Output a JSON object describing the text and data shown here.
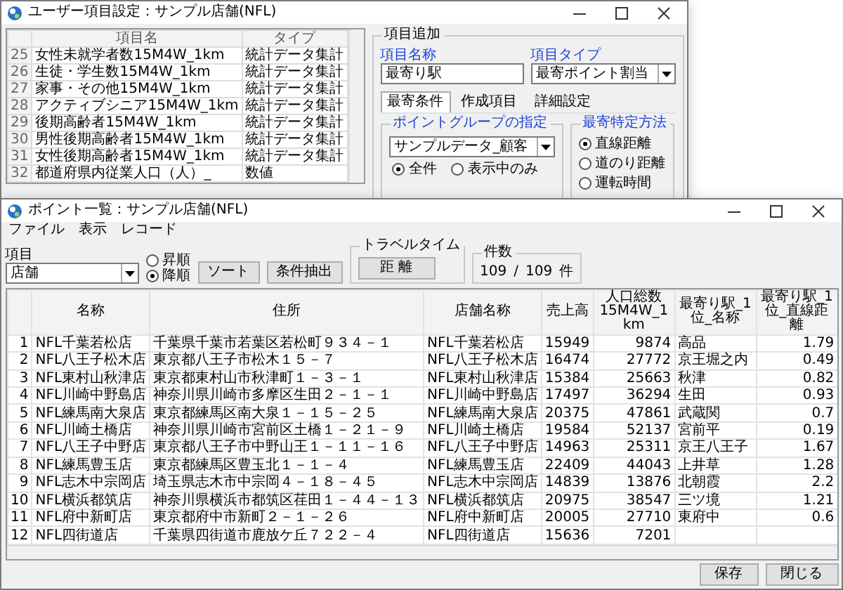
{
  "back_window": {
    "title": "ユーザー項目設定：サンプル店舗(NFL)",
    "list": {
      "columns": [
        "項目名",
        "タイプ"
      ],
      "rows": [
        {
          "number": "25",
          "name": "女性未就学者数15M4W_1km",
          "type": "統計データ集計"
        },
        {
          "number": "26",
          "name": "生徒・学生数15M4W_1km",
          "type": "統計データ集計"
        },
        {
          "number": "27",
          "name": "家事・その他15M4W_1km",
          "type": "統計データ集計"
        },
        {
          "number": "28",
          "name": "アクティブシニア15M4W_1km",
          "type": "統計データ集計"
        },
        {
          "number": "29",
          "name": "後期高齢者15M4W_1km",
          "type": "統計データ集計"
        },
        {
          "number": "30",
          "name": "男性後期高齢者15M4W_1km",
          "type": "統計データ集計"
        },
        {
          "number": "31",
          "name": "女性後期高齢者15M4W_1km",
          "type": "統計データ集計"
        },
        {
          "number": "32",
          "name": "都道府県内従業人口（人）_",
          "type": "数値"
        }
      ]
    },
    "add_item": {
      "title": "項目追加",
      "name_label": "項目名称",
      "name_value": "最寄り駅",
      "type_label": "項目タイプ",
      "type_value": "最寄ポイント割当",
      "tabs": [
        {
          "label": "最寄条件",
          "selected": true
        },
        {
          "label": "作成項目",
          "selected": false
        },
        {
          "label": "詳細設定",
          "selected": false
        }
      ],
      "point_group": {
        "title": "ポイントグループの指定",
        "value": "サンプルデータ_顧客",
        "radios": [
          {
            "label": "全件",
            "selected": true
          },
          {
            "label": "表示中のみ",
            "selected": false
          }
        ]
      },
      "method": {
        "title": "最寄特定方法",
        "radios": [
          {
            "label": "直線距離",
            "selected": true
          },
          {
            "label": "道のり距離",
            "selected": false
          },
          {
            "label": "運転時間",
            "selected": false
          }
        ]
      }
    }
  },
  "front_window": {
    "title": "ポイント一覧：サンプル店舗(NFL)",
    "menu": [
      "ファイル",
      "表示",
      "レコード"
    ],
    "field": {
      "label": "項目",
      "value": "店舗"
    },
    "order": [
      {
        "label": "昇順",
        "selected": false
      },
      {
        "label": "降順",
        "selected": true
      }
    ],
    "buttons": [
      "ソート",
      "条件抽出"
    ],
    "travel": {
      "title": "トラベルタイム",
      "button": "距 離"
    },
    "count": {
      "title": "件数",
      "shown": "109",
      "separator": "/",
      "total": "109",
      "unit": "件"
    },
    "table": {
      "columns": [
        "名称",
        "住所",
        "店舗名称",
        "売上高",
        "人口総数15M4W_1km",
        "最寄り駅_1位_名称",
        "最寄り駅_1位_直線距離"
      ],
      "rows": [
        {
          "number": "1",
          "cells": [
            "NFL千葉若松店",
            "千葉県千葉市若葉区若松町９３４－１",
            "NFL千葉若松店",
            "15949",
            "9874",
            "高品",
            "1.79"
          ]
        },
        {
          "number": "2",
          "cells": [
            "NFL八王子松木店",
            "東京都八王子市松木１５－７",
            "NFL八王子松木店",
            "16474",
            "27772",
            "京王堀之内",
            "0.49"
          ]
        },
        {
          "number": "3",
          "cells": [
            "NFL東村山秋津店",
            "東京都東村山市秋津町１－３－１",
            "NFL東村山秋津店",
            "15384",
            "25663",
            "秋津",
            "0.82"
          ]
        },
        {
          "number": "4",
          "cells": [
            "NFL川崎中野島店",
            "神奈川県川崎市多摩区生田２－１－１",
            "NFL川崎中野島店",
            "17497",
            "36294",
            "生田",
            "0.93"
          ]
        },
        {
          "number": "5",
          "cells": [
            "NFL練馬南大泉店",
            "東京都練馬区南大泉１－１５－２５",
            "NFL練馬南大泉店",
            "20375",
            "47861",
            "武蔵関",
            "0.7"
          ]
        },
        {
          "number": "6",
          "cells": [
            "NFL川崎土橋店",
            "神奈川県川崎市宮前区土橋１－２１－９",
            "NFL川崎土橋店",
            "19584",
            "52137",
            "宮前平",
            "0.19"
          ]
        },
        {
          "number": "7",
          "cells": [
            "NFL八王子中野店",
            "東京都八王子市中野山王１－１１－１６",
            "NFL八王子中野店",
            "14963",
            "25311",
            "京王八王子",
            "1.67"
          ]
        },
        {
          "number": "8",
          "cells": [
            "NFL練馬豊玉店",
            "東京都練馬区豊玉北１－１－４",
            "NFL練馬豊玉店",
            "22409",
            "44043",
            "上井草",
            "1.28"
          ]
        },
        {
          "number": "9",
          "cells": [
            "NFL志木中宗岡店",
            "埼玉県志木市中宗岡４－１８－４５",
            "NFL志木中宗岡店",
            "14839",
            "13876",
            "北朝霞",
            "2.2"
          ]
        },
        {
          "number": "10",
          "cells": [
            "NFL横浜都筑店",
            "神奈川県横浜市都筑区荏田１－４４－１３",
            "NFL横浜都筑店",
            "20975",
            "38547",
            "三ツ境",
            "1.21"
          ]
        },
        {
          "number": "11",
          "cells": [
            "NFL府中新町店",
            "東京都府中市新町２－１－２６",
            "NFL府中新町店",
            "20005",
            "27710",
            "東府中",
            "0.6"
          ]
        },
        {
          "number": "12",
          "cells": [
            "NFL四街道店",
            "千葉県四街道市鹿放ケ丘７２２－４",
            "NFL四街道店",
            "15636",
            "7201",
            "",
            ""
          ]
        }
      ]
    },
    "footer_buttons": [
      "保存",
      "閉じる"
    ]
  }
}
